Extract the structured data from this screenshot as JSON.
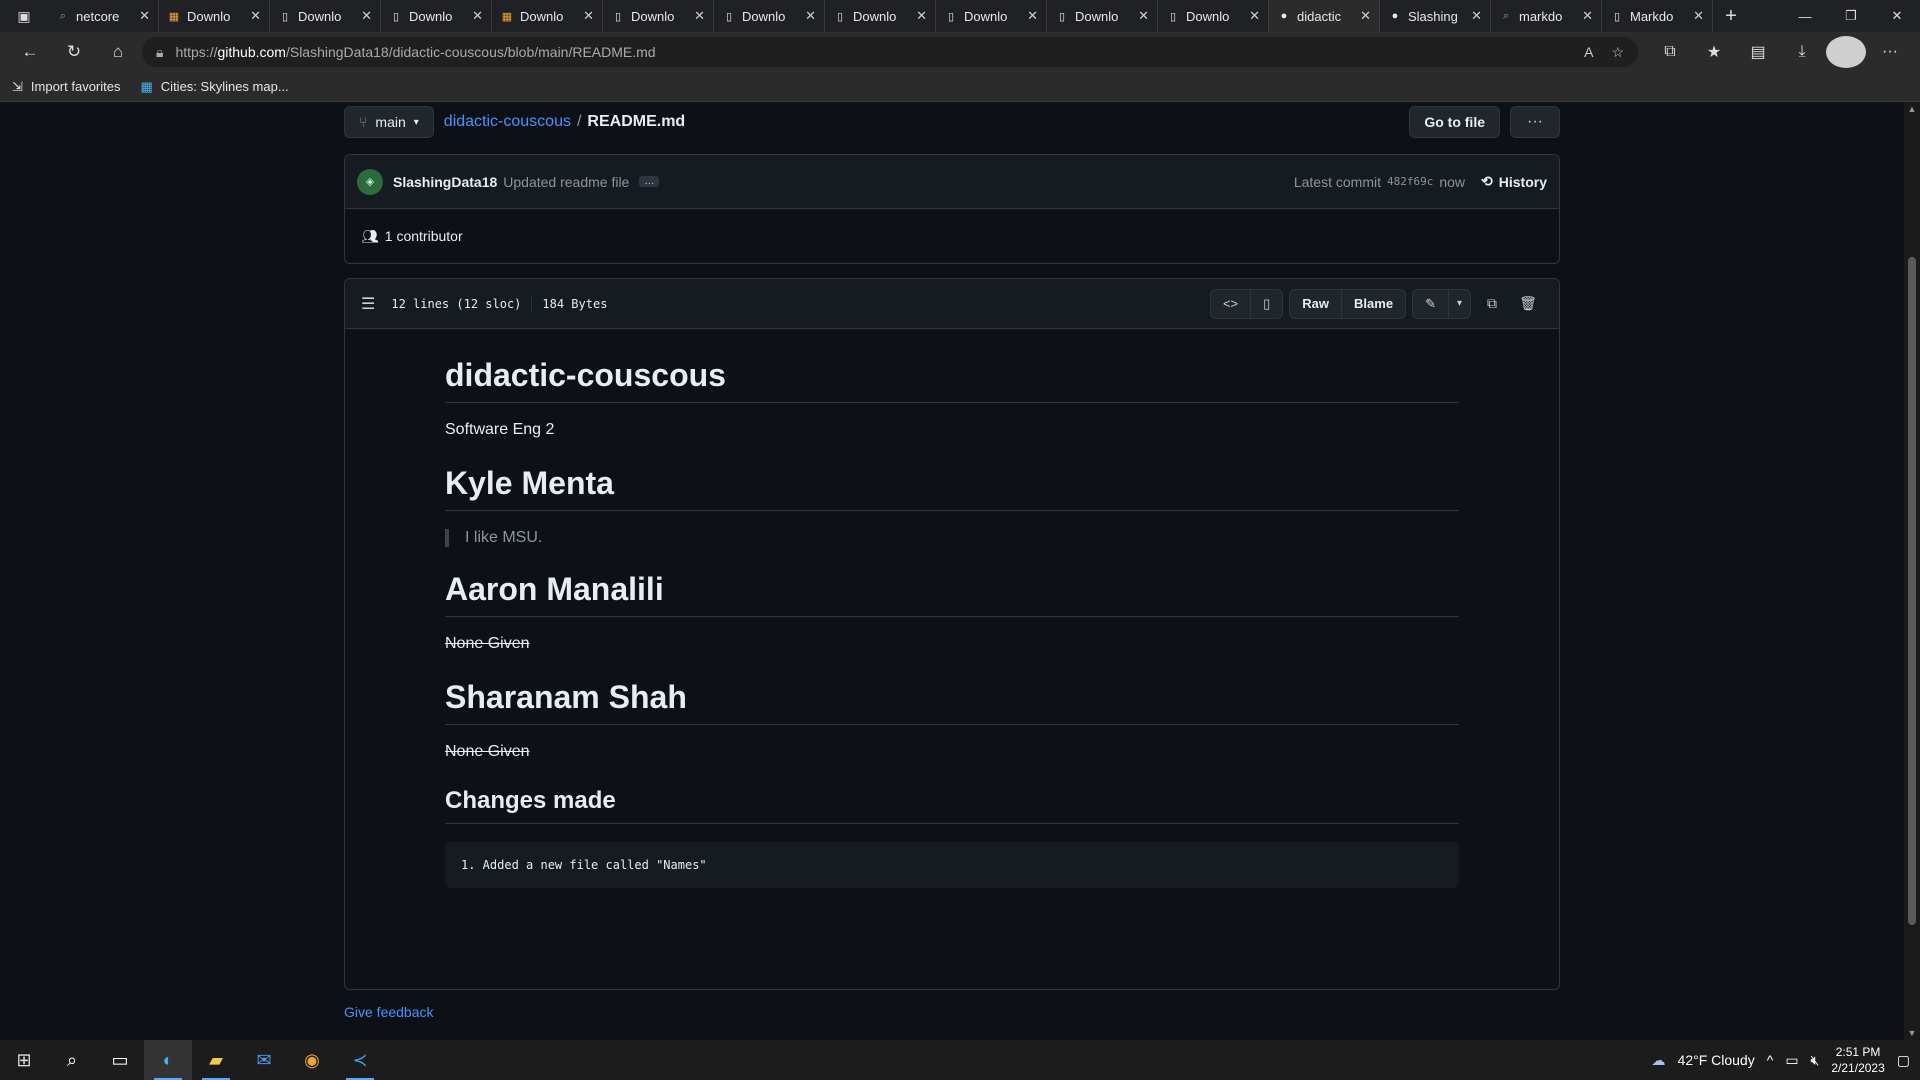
{
  "browser": {
    "tabs": [
      {
        "title": "netcore",
        "icon": "search-icon"
      },
      {
        "title": "Downlo",
        "icon": "microsoft-icon"
      },
      {
        "title": "Downlo",
        "icon": "page-icon"
      },
      {
        "title": "Downlo",
        "icon": "page-icon"
      },
      {
        "title": "Downlo",
        "icon": "microsoft-icon"
      },
      {
        "title": "Downlo",
        "icon": "page-icon"
      },
      {
        "title": "Downlo",
        "icon": "page-icon"
      },
      {
        "title": "Downlo",
        "icon": "page-icon"
      },
      {
        "title": "Downlo",
        "icon": "page-icon"
      },
      {
        "title": "Downlo",
        "icon": "page-icon"
      },
      {
        "title": "Downlo",
        "icon": "page-icon"
      },
      {
        "title": "didactic",
        "icon": "github-icon",
        "active": true
      },
      {
        "title": "Slashing",
        "icon": "github-icon"
      },
      {
        "title": "markdo",
        "icon": "search-icon"
      },
      {
        "title": "Markdo",
        "icon": "page-icon"
      }
    ],
    "url_prefix": "https://",
    "url_domain": "github.com",
    "url_path": "/SlashingData18/didactic-couscous/blob/main/README.md",
    "favorites": [
      "Import favorites",
      "Cities: Skylines map..."
    ]
  },
  "repo": {
    "branch": "main",
    "repo_name": "didactic-couscous",
    "separator": "/",
    "file_name": "README.md",
    "go_to_file": "Go to file",
    "more": "···"
  },
  "commit": {
    "author": "SlashingData18",
    "message": "Updated readme file",
    "ellipsis": "…",
    "latest_label": "Latest commit",
    "sha": "482f69c",
    "time": "now",
    "history": "History",
    "contributors": "1 contributor"
  },
  "file": {
    "lines": "12 lines (12 sloc)",
    "size": "184 Bytes",
    "raw": "Raw",
    "blame": "Blame"
  },
  "readme": {
    "title": "didactic-couscous",
    "subtitle": "Software Eng 2",
    "person1": "Kyle Menta",
    "quote1": "I like MSU.",
    "person2": "Aaron Manalili",
    "none2": "None Given",
    "person3": "Sharanam Shah",
    "none3": "None Given",
    "changes_heading": "Changes made",
    "code_line": "1. Added a new file called \"Names\""
  },
  "footer": {
    "feedback": "Give feedback"
  },
  "taskbar": {
    "weather": "42°F  Cloudy",
    "time": "2:51 PM",
    "date": "2/21/2023"
  },
  "colors": {
    "accent": "#4493f8",
    "bg": "#0d1117",
    "border": "#30363d"
  }
}
